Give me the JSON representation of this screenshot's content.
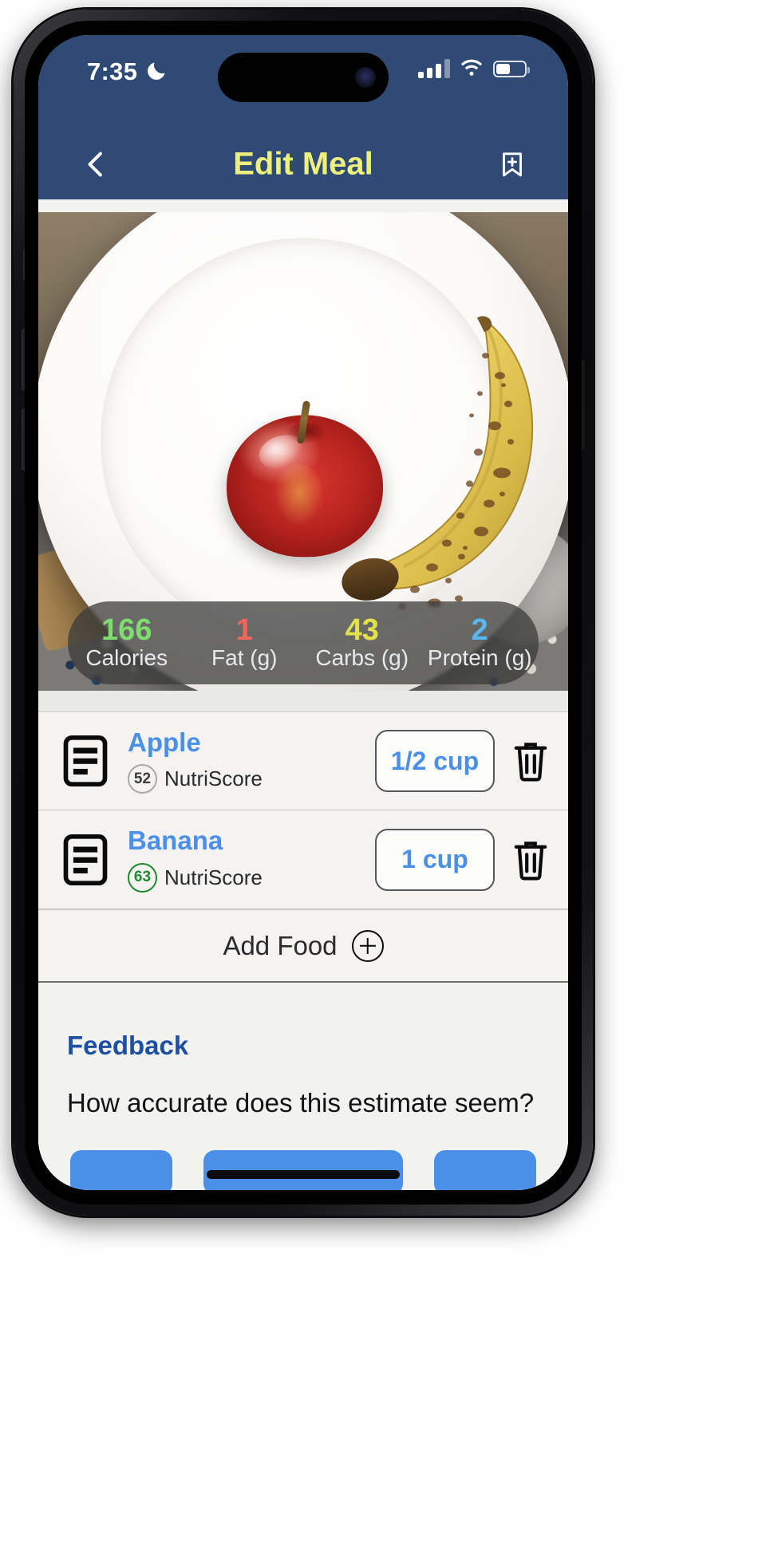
{
  "status_bar": {
    "time": "7:35",
    "moon_icon": "crescent-moon-icon",
    "cellular_icon": "cellular-signal-icon",
    "wifi_icon": "wifi-icon",
    "battery_icon": "battery-icon",
    "battery_level_pct": 46
  },
  "nav_bar": {
    "back_icon": "chevron-left-icon",
    "title": "Edit Meal",
    "title_color": "#eef07e",
    "bar_color": "#2f4a75",
    "bookmark_icon": "bookmark-add-icon"
  },
  "meal_photo": {
    "alt": "white plate with a red apple and a ripe spotted banana on a countertop"
  },
  "nutrition": [
    {
      "value": "166",
      "label": "Calories",
      "color": "#7fdc6f"
    },
    {
      "value": "1",
      "label": "Fat (g)",
      "color": "#f2655c"
    },
    {
      "value": "43",
      "label": "Carbs (g)",
      "color": "#e2e24a"
    },
    {
      "value": "2",
      "label": "Protein (g)",
      "color": "#59b6ef"
    }
  ],
  "foods": [
    {
      "doc_icon": "document-icon",
      "name": "Apple",
      "score": "52",
      "score_label": "NutriScore",
      "score_color": "#a8a8a6",
      "portion": "1/2 cup",
      "delete_icon": "trash-icon"
    },
    {
      "doc_icon": "document-icon",
      "name": "Banana",
      "score": "63",
      "score_label": "NutriScore",
      "score_color": "#1f8a2e",
      "portion": "1 cup",
      "delete_icon": "trash-icon"
    }
  ],
  "add_food": {
    "label": "Add Food",
    "icon": "plus-circle-icon"
  },
  "feedback": {
    "heading": "Feedback",
    "question": "How accurate does this estimate seem?",
    "button_color": "#4a90e8"
  },
  "colors": {
    "header": "#2f4a75",
    "accent_blue": "#4a90e8",
    "link_blue": "#1d4fa3",
    "page_bg": "#f2f2f0"
  }
}
